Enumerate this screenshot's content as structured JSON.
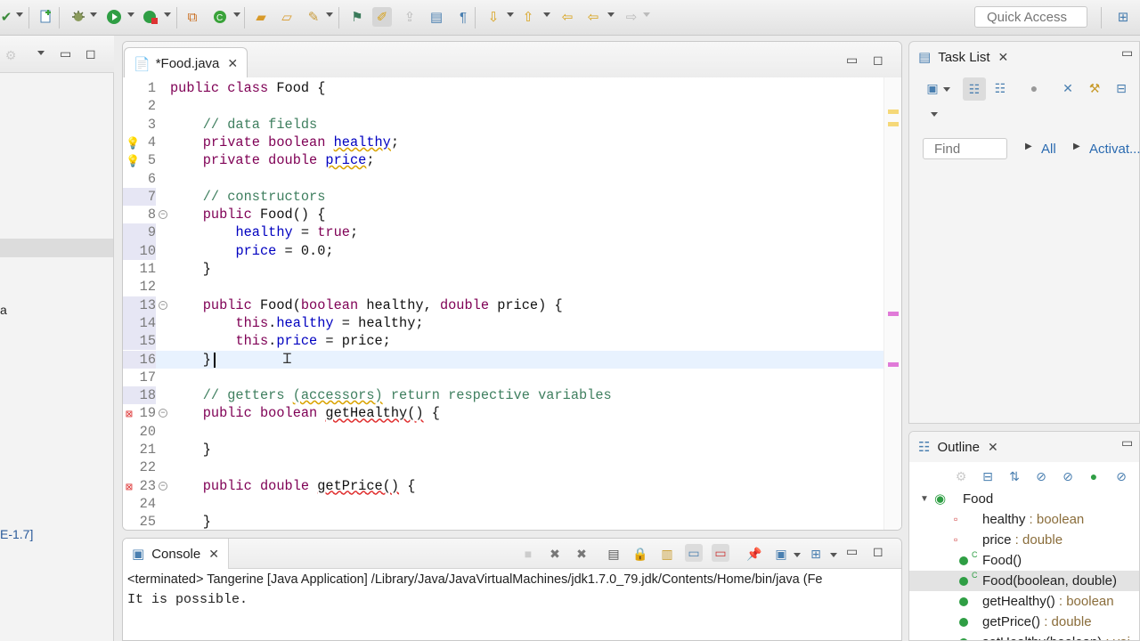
{
  "toolbar": {
    "quick_access_placeholder": "Quick Access"
  },
  "left_panel": {
    "text_a": "a",
    "text_e": "E-1.7]"
  },
  "editor": {
    "tab_label": "*Food.java",
    "lines": [
      {
        "n": "1",
        "html": "<span class='kw'>public class</span> Food {"
      },
      {
        "n": "2",
        "html": ""
      },
      {
        "n": "3",
        "html": "    <span class='cm'>// data fields</span>"
      },
      {
        "n": "4",
        "html": "    <span class='kw'>private boolean</span> <span class='fld warn'>healthy</span>;"
      },
      {
        "n": "5",
        "html": "    <span class='kw'>private double</span> <span class='fld warn'>price</span>;"
      },
      {
        "n": "6",
        "html": ""
      },
      {
        "n": "7",
        "html": "    <span class='cm'>// constructors</span>"
      },
      {
        "n": "8",
        "html": "    <span class='kw'>public</span> Food() {"
      },
      {
        "n": "9",
        "html": "        <span class='fld'>healthy</span> = <span class='kw'>true</span>;"
      },
      {
        "n": "10",
        "html": "        <span class='fld'>price</span> = 0.0;"
      },
      {
        "n": "11",
        "html": "    }"
      },
      {
        "n": "12",
        "html": ""
      },
      {
        "n": "13",
        "html": "    <span class='kw'>public</span> Food(<span class='kw'>boolean</span> healthy, <span class='kw'>double</span> price) {"
      },
      {
        "n": "14",
        "html": "        <span class='kw'>this</span>.<span class='fld'>healthy</span> = healthy;"
      },
      {
        "n": "15",
        "html": "        <span class='kw'>this</span>.<span class='fld'>price</span> = price;"
      },
      {
        "n": "16",
        "html": "    }"
      },
      {
        "n": "17",
        "html": ""
      },
      {
        "n": "18",
        "html": "    <span class='cm'>// getters <span class='warn'>(accessors)</span> return respective variables</span>"
      },
      {
        "n": "19",
        "html": "    <span class='kw'>public boolean</span> <span class='err'>getHealthy()</span> {"
      },
      {
        "n": "20",
        "html": ""
      },
      {
        "n": "21",
        "html": "    }"
      },
      {
        "n": "22",
        "html": ""
      },
      {
        "n": "23",
        "html": "    <span class='kw'>public double</span> <span class='err'>getPrice()</span> {"
      },
      {
        "n": "24",
        "html": ""
      },
      {
        "n": "25",
        "html": "    }"
      }
    ]
  },
  "console": {
    "tab_label": "Console",
    "terminated_line": "<terminated> Tangerine [Java Application] /Library/Java/JavaVirtualMachines/jdk1.7.0_79.jdk/Contents/Home/bin/java (Fe",
    "output": "It is possible."
  },
  "task_list": {
    "tab_label": "Task List",
    "find_placeholder": "Find",
    "all_label": "All",
    "activate_label": "Activat..."
  },
  "outline": {
    "tab_label": "Outline",
    "root": "Food",
    "items": [
      {
        "name": "healthy",
        "type": " : boolean"
      },
      {
        "name": "price",
        "type": " : double"
      },
      {
        "name": "Food()",
        "type": ""
      },
      {
        "name": "Food(boolean, double)",
        "type": ""
      },
      {
        "name": "getHealthy()",
        "type": " : boolean"
      },
      {
        "name": "getPrice()",
        "type": " : double"
      },
      {
        "name": "setHealthy(boolean)",
        "type": " : voi"
      }
    ]
  }
}
